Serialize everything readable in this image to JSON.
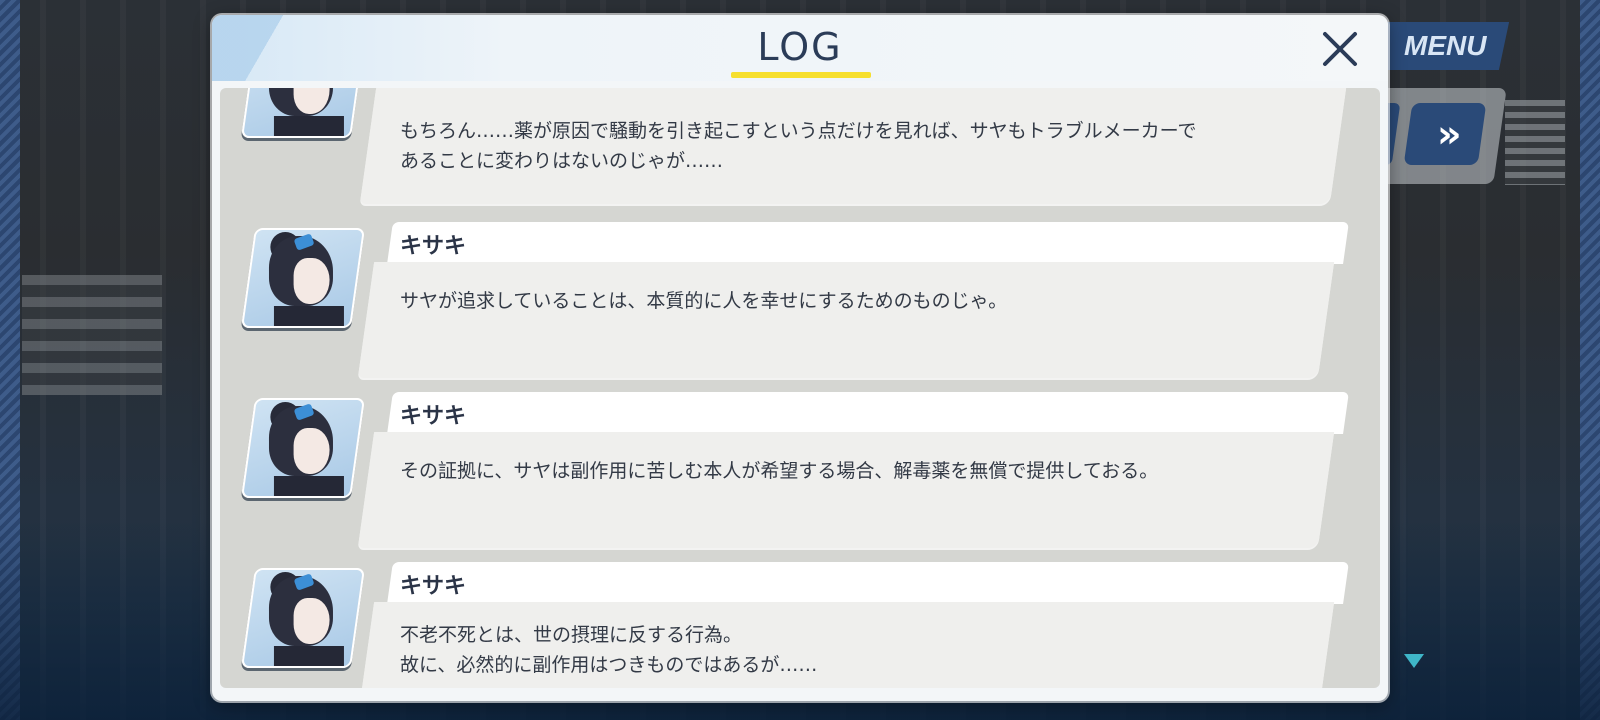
{
  "background": {
    "menu_label": "MENU",
    "fast_forward_glyph": "»",
    "next_icon": "triangle-down-icon"
  },
  "log_panel": {
    "title": "LOG",
    "close_icon": "close-icon",
    "accent_color": "#f6df2e",
    "title_color": "#2b3c58"
  },
  "entries": [
    {
      "speaker": "",
      "lines": [
        "もちろん……薬が原因で騒動を引き起こすという点だけを見れば、サヤもトラブルメーカーで",
        "あることに変わりはないのじゃが……"
      ]
    },
    {
      "speaker": "キサキ",
      "lines": [
        "サヤが追求していることは、本質的に人を幸せにするためのものじゃ。"
      ]
    },
    {
      "speaker": "キサキ",
      "lines": [
        "その証拠に、サヤは副作用に苦しむ本人が希望する場合、解毒薬を無償で提供しておる。"
      ]
    },
    {
      "speaker": "キサキ",
      "lines": [
        "不老不死とは、世の摂理に反する行為。",
        "故に、必然的に副作用はつきものではあるが……"
      ]
    }
  ]
}
